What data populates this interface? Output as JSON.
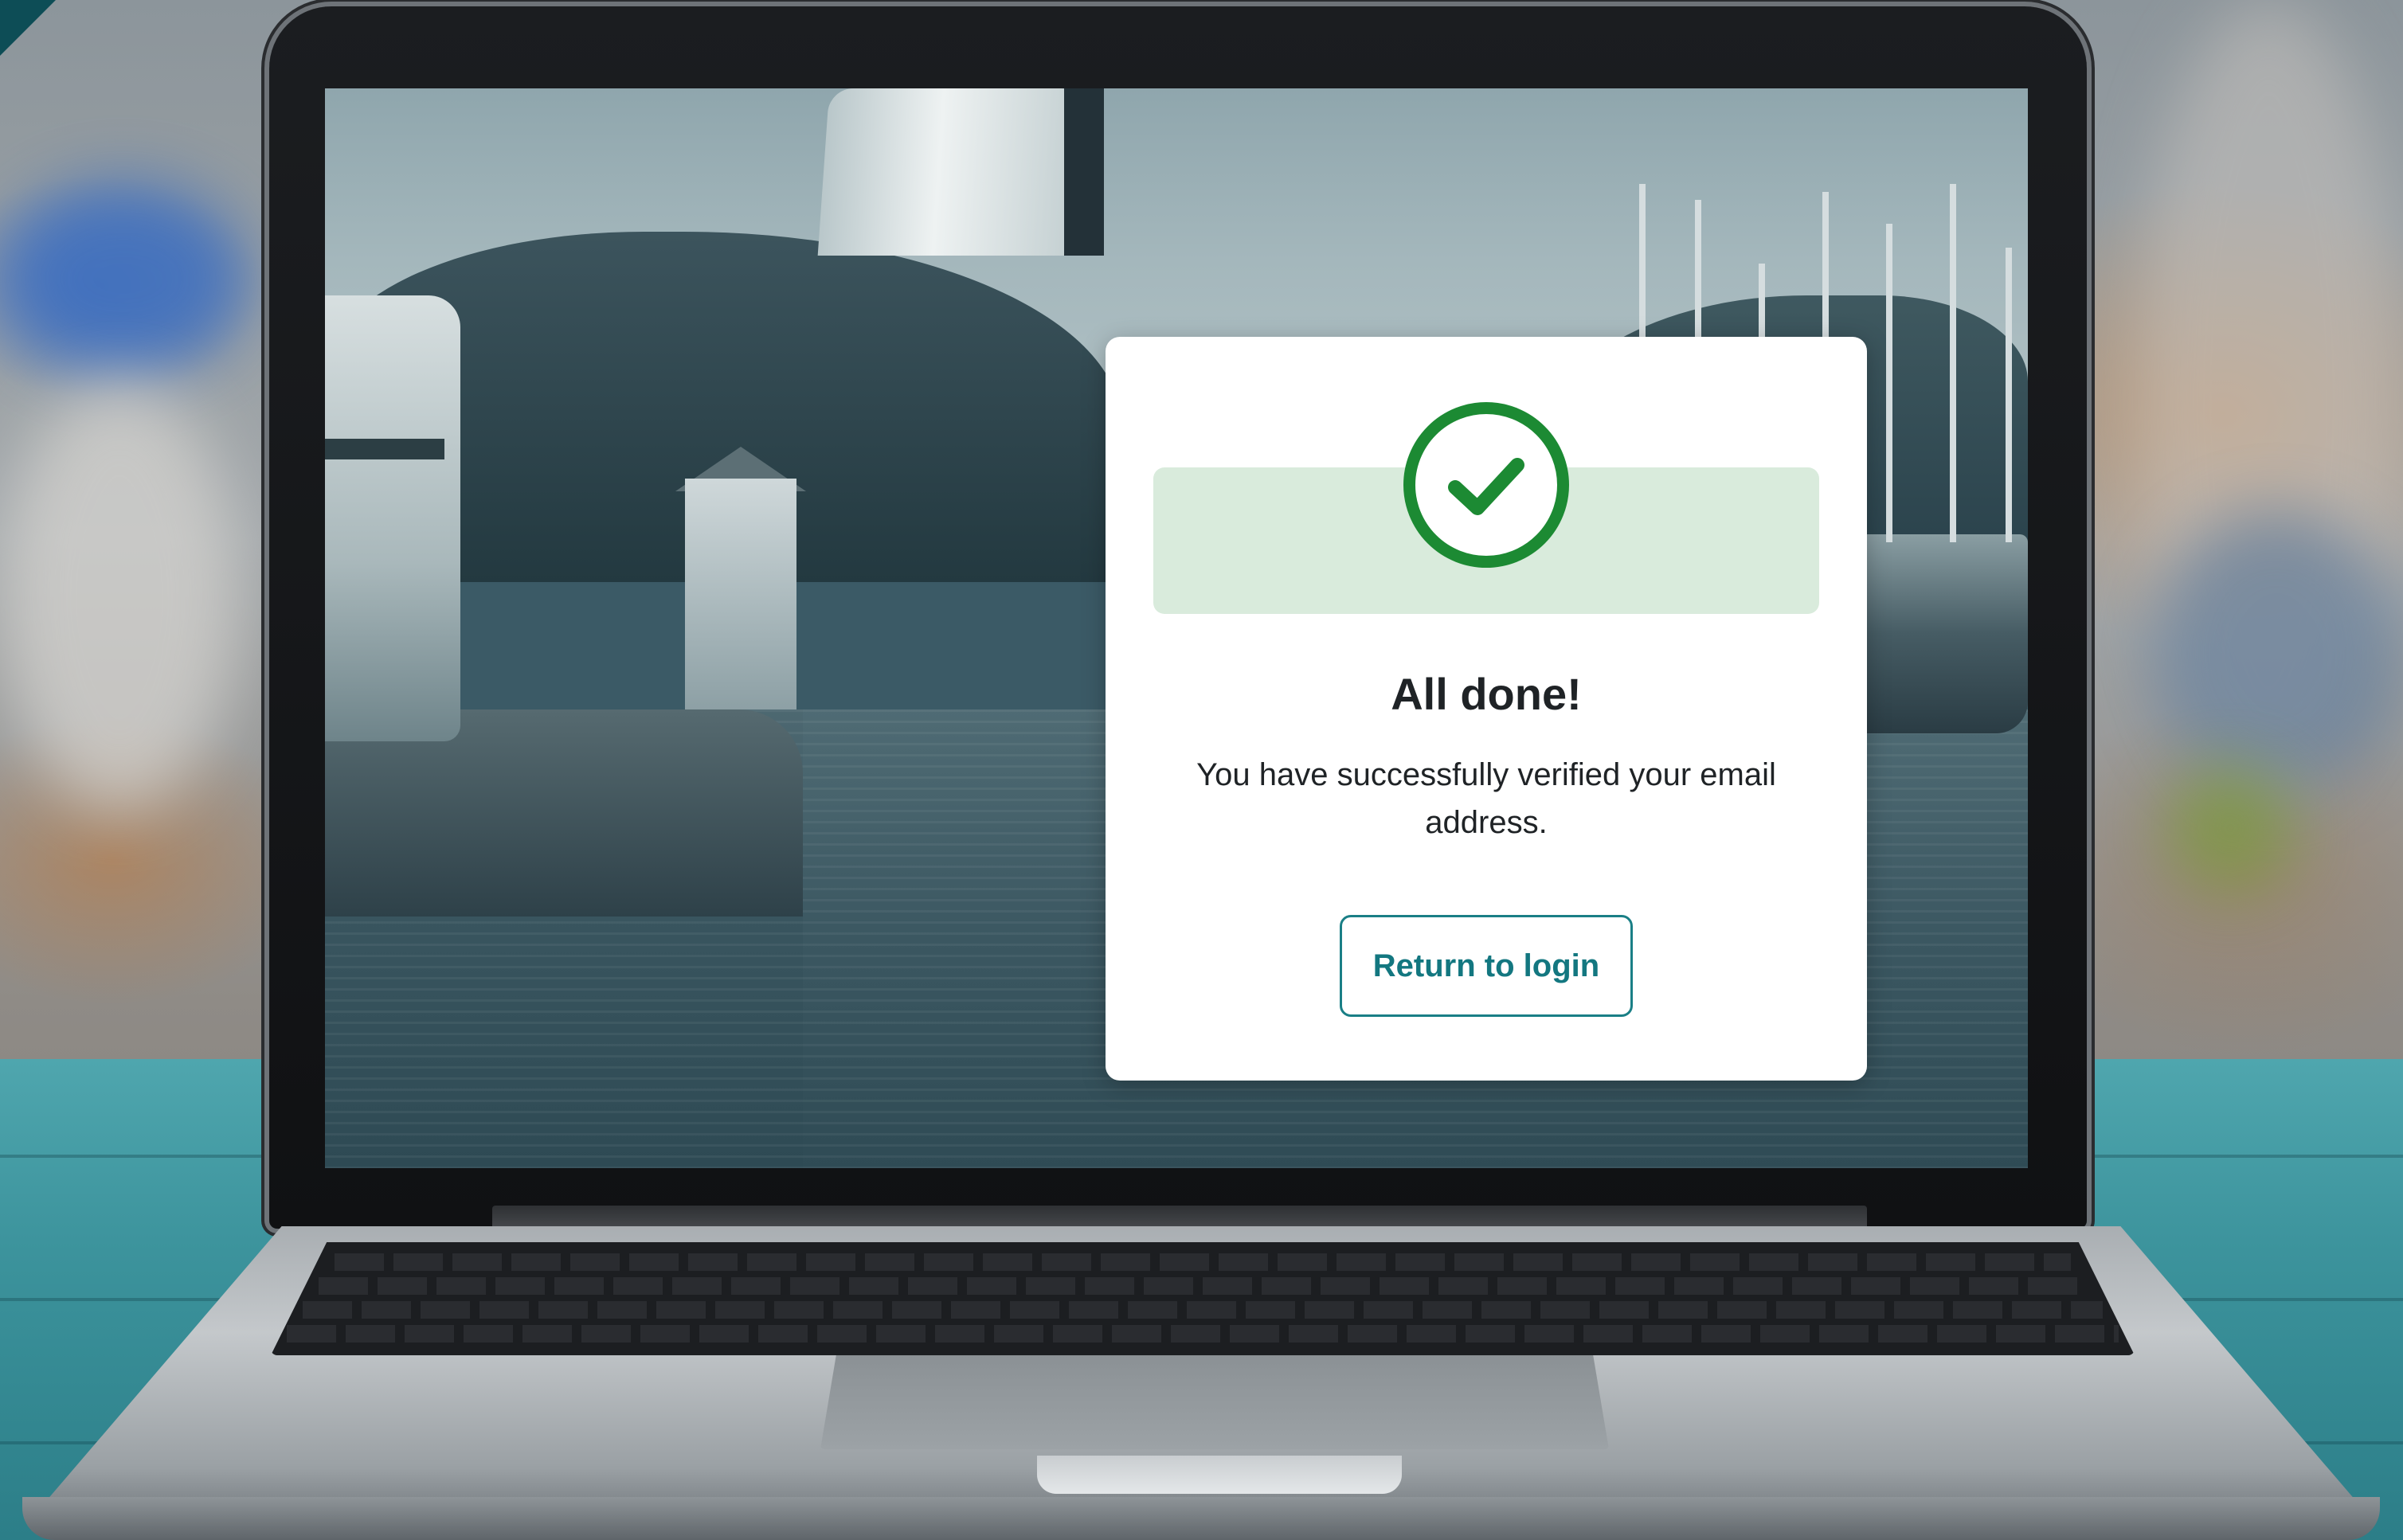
{
  "dialog": {
    "title": "All done!",
    "message": "You have successfully verified your email address.",
    "return_button_label": "Return to login",
    "status_icon": "check-circle-icon"
  },
  "colors": {
    "success_green": "#1c8a33",
    "success_banner_bg": "#d9ebdc",
    "button_teal": "#137780",
    "card_bg": "#ffffff",
    "text_dark": "#1f2326"
  }
}
